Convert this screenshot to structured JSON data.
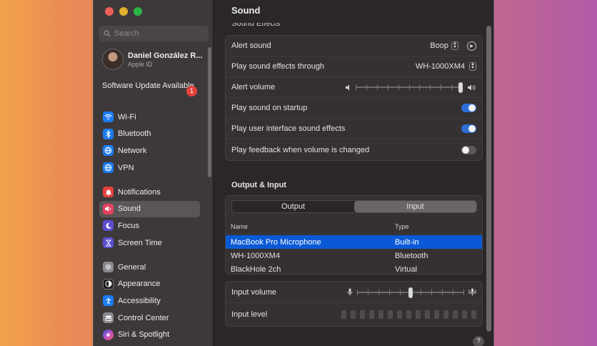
{
  "window": {
    "title": "Sound",
    "traffic_colors": [
      "#ec5f57",
      "#e0b12f",
      "#2bb646"
    ]
  },
  "sidebar": {
    "search_placeholder": "Search",
    "profile": {
      "name": "Daniel González R...",
      "sub": "Apple ID"
    },
    "update": {
      "label": "Software Update Available",
      "badge": "1"
    },
    "group1": [
      {
        "label": "Wi-Fi",
        "icon": "wifi-icon",
        "color": "#1b7cf2"
      },
      {
        "label": "Bluetooth",
        "icon": "bluetooth-icon",
        "color": "#1b7cf2"
      },
      {
        "label": "Network",
        "icon": "globe-icon",
        "color": "#1b7cf2"
      },
      {
        "label": "VPN",
        "icon": "vpn-globe-icon",
        "color": "#1b7cf2"
      }
    ],
    "group2": [
      {
        "label": "Notifications",
        "icon": "bell-icon",
        "color": "#e5413b"
      },
      {
        "label": "Sound",
        "icon": "speaker-icon",
        "color": "#e5415f"
      },
      {
        "label": "Focus",
        "icon": "moon-icon",
        "color": "#5b4fd1"
      },
      {
        "label": "Screen Time",
        "icon": "hourglass-icon",
        "color": "#5b4fd1"
      }
    ],
    "group3": [
      {
        "label": "General",
        "icon": "gear-icon",
        "color": "#8a8a8e"
      },
      {
        "label": "Appearance",
        "icon": "appearance-icon",
        "color": "#1c1c1c"
      },
      {
        "label": "Accessibility",
        "icon": "accessibility-icon",
        "color": "#1b7cf2"
      },
      {
        "label": "Control Center",
        "icon": "control-center-icon",
        "color": "#8a8a8e"
      },
      {
        "label": "Siri & Spotlight",
        "icon": "siri-icon",
        "color": "#b04fc9"
      }
    ]
  },
  "sound_effects": {
    "section_title": "Sound Effects",
    "alert_sound": {
      "label": "Alert sound",
      "value": "Boop"
    },
    "play_through": {
      "label": "Play sound effects through",
      "value": "WH-1000XM4"
    },
    "alert_volume": {
      "label": "Alert volume",
      "level": 1.0
    },
    "startup": {
      "label": "Play sound on startup",
      "on": true
    },
    "ui_effects": {
      "label": "Play user interface sound effects",
      "on": true
    },
    "feedback": {
      "label": "Play feedback when volume is changed",
      "on": false
    }
  },
  "output_input": {
    "title": "Output & Input",
    "tabs": [
      "Output",
      "Input"
    ],
    "selected_tab": "Input",
    "columns": [
      "Name",
      "Type"
    ],
    "devices": [
      {
        "name": "MacBook Pro Microphone",
        "type": "Built-in",
        "selected": true
      },
      {
        "name": "WH-1000XM4",
        "type": "Bluetooth",
        "selected": false
      },
      {
        "name": "BlackHole 2ch",
        "type": "Virtual",
        "selected": false
      }
    ],
    "input_volume": {
      "label": "Input volume",
      "level": 0.5
    },
    "input_level": {
      "label": "Input level"
    }
  },
  "help_label": "?"
}
